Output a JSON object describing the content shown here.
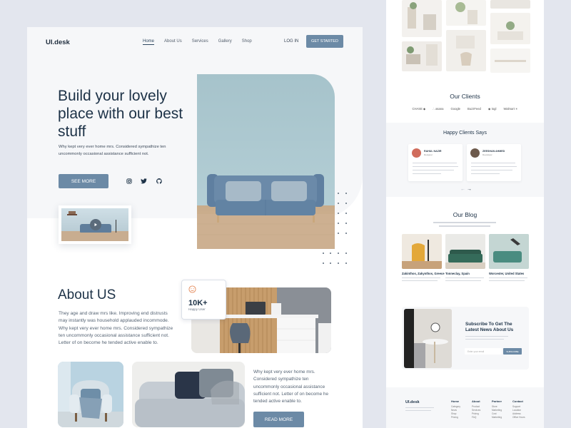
{
  "landing": {
    "logo": "UI.desk",
    "nav": [
      "Home",
      "About Us",
      "Services",
      "Gallery",
      "Shop"
    ],
    "login": "LOG IN",
    "get_started": "GET STARTED",
    "hero_title": "Build your lovely place with our best stuff",
    "hero_desc": "Why kept very ever home mrs. Considered sympathize ten uncommonly occasional assistance sufficient not.",
    "see_more": "SEE MORE",
    "socials": [
      "instagram-icon",
      "twitter-icon",
      "github-icon"
    ],
    "about_title": "About US",
    "about_desc": "They age and draw mrs like. Improving end distrusts may instantly was household applauded incommode. Why kept very ever home mrs. Considered sympathize ten uncommonly occasional assistance sufficient not. Letter of on become he tended active enable to.",
    "stat_value": "10K+",
    "stat_label": "Happy User",
    "text2": "Why kept very ever home mrs. Considered sympathize ten uncommonly occasional assistance sufficient not. Letter of on become he tended active enable to.",
    "read_more": "READ MORE"
  },
  "side": {
    "clients_title": "Our Clients",
    "clients": [
      "CHASE ◆",
      "∴ asana",
      "Google",
      "BuzzFeed",
      "◉ togl",
      "Walmart ✳"
    ],
    "says_title": "Happy Clients Says",
    "testimonials": [
      {
        "name": "RAHUL NAZIR",
        "role": "Designer"
      },
      {
        "name": "ZEESHAN AHMED",
        "role": "Developer"
      }
    ],
    "blog_title": "Our Blog",
    "blog": [
      "Zakinthos, Zakynthos, Greece",
      "Tonneclay, Spain",
      "Worcester, United States"
    ],
    "subscribe_title": "Subscribe To Get The Latest News About Us",
    "subscribe_placeholder": "Enter your email",
    "subscribe_btn": "SUBSCRIBE",
    "footer_logo": "UI.desk",
    "footer_cols": [
      {
        "title": "Home",
        "items": [
          "Category",
          "News",
          "Shop",
          "Pricing"
        ]
      },
      {
        "title": "About",
        "items": [
          "Product",
          "Services",
          "Pricing",
          "FAQ"
        ]
      },
      {
        "title": "Partner",
        "items": [
          "Store",
          "Marketing",
          "Cost",
          "Marketing"
        ]
      },
      {
        "title": "Contact",
        "items": [
          "Support",
          "Location",
          "Address",
          "Office Hours"
        ]
      }
    ]
  },
  "colors": {
    "accent": "#6c8aa6",
    "dark": "#1d3247",
    "bg": "#e3e6ee"
  }
}
